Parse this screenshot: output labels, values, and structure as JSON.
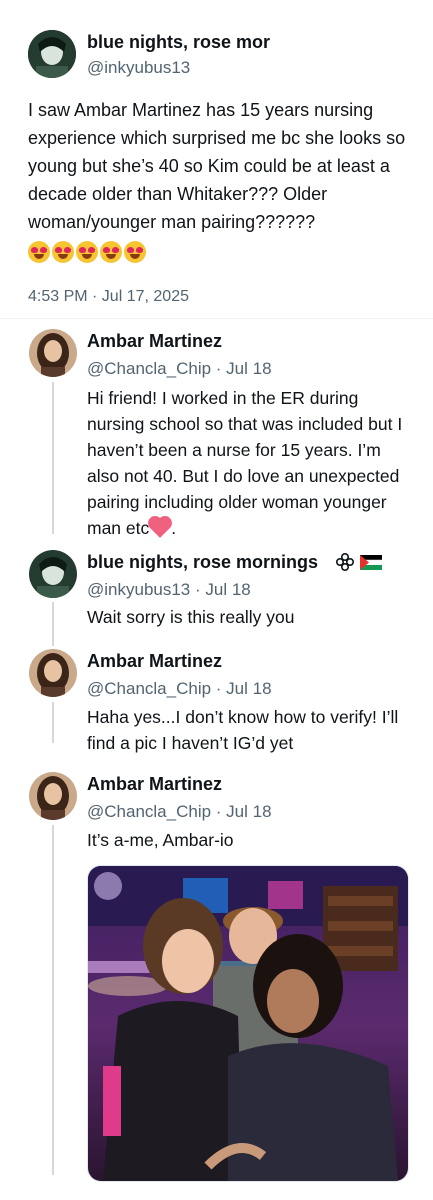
{
  "main_tweet": {
    "author_name": "blue nights, rose mor",
    "handle": "@inkyubus13",
    "text": "I saw Ambar Martinez has 15 years nursing experience which surprised me bc she looks so young but she’s 40 so Kim could be at least a decade older than Whitaker??? Older woman/younger man pairing??????",
    "emoji_count": 5,
    "timestamp": "4:53 PM · Jul 17, 2025"
  },
  "replies": [
    {
      "author_name": "Ambar Martinez",
      "meta": "@Chancla_Chip · Jul 18",
      "text": "Hi friend! I worked in the ER during nursing school so that was included but I haven’t been a nurse for 15 years. I’m also not 40. But I do love an unexpected pairing including older woman younger man etc",
      "text_end": "."
    },
    {
      "author_name": "blue nights, rose mornings",
      "meta": "@inkyubus13 · Jul 18",
      "text": "Wait sorry is this really you"
    },
    {
      "author_name": "Ambar Martinez",
      "meta": "@Chancla_Chip · Jul 18",
      "text": "Haha yes...I don’t know how to verify! I’ll find a pic I haven’t IG’d yet"
    },
    {
      "author_name": "Ambar Martinez",
      "meta": "@Chancla_Chip · Jul 18",
      "text": "It’s a-me, Ambar-io"
    }
  ],
  "colors": {
    "text": "#0f1419",
    "secondary": "#536471",
    "thread_line": "#cfd9de"
  },
  "icons": [
    "avatar-image",
    "flower-icon",
    "flag-icon",
    "heart-emoji",
    "heart-eyes-emoji",
    "photo"
  ]
}
